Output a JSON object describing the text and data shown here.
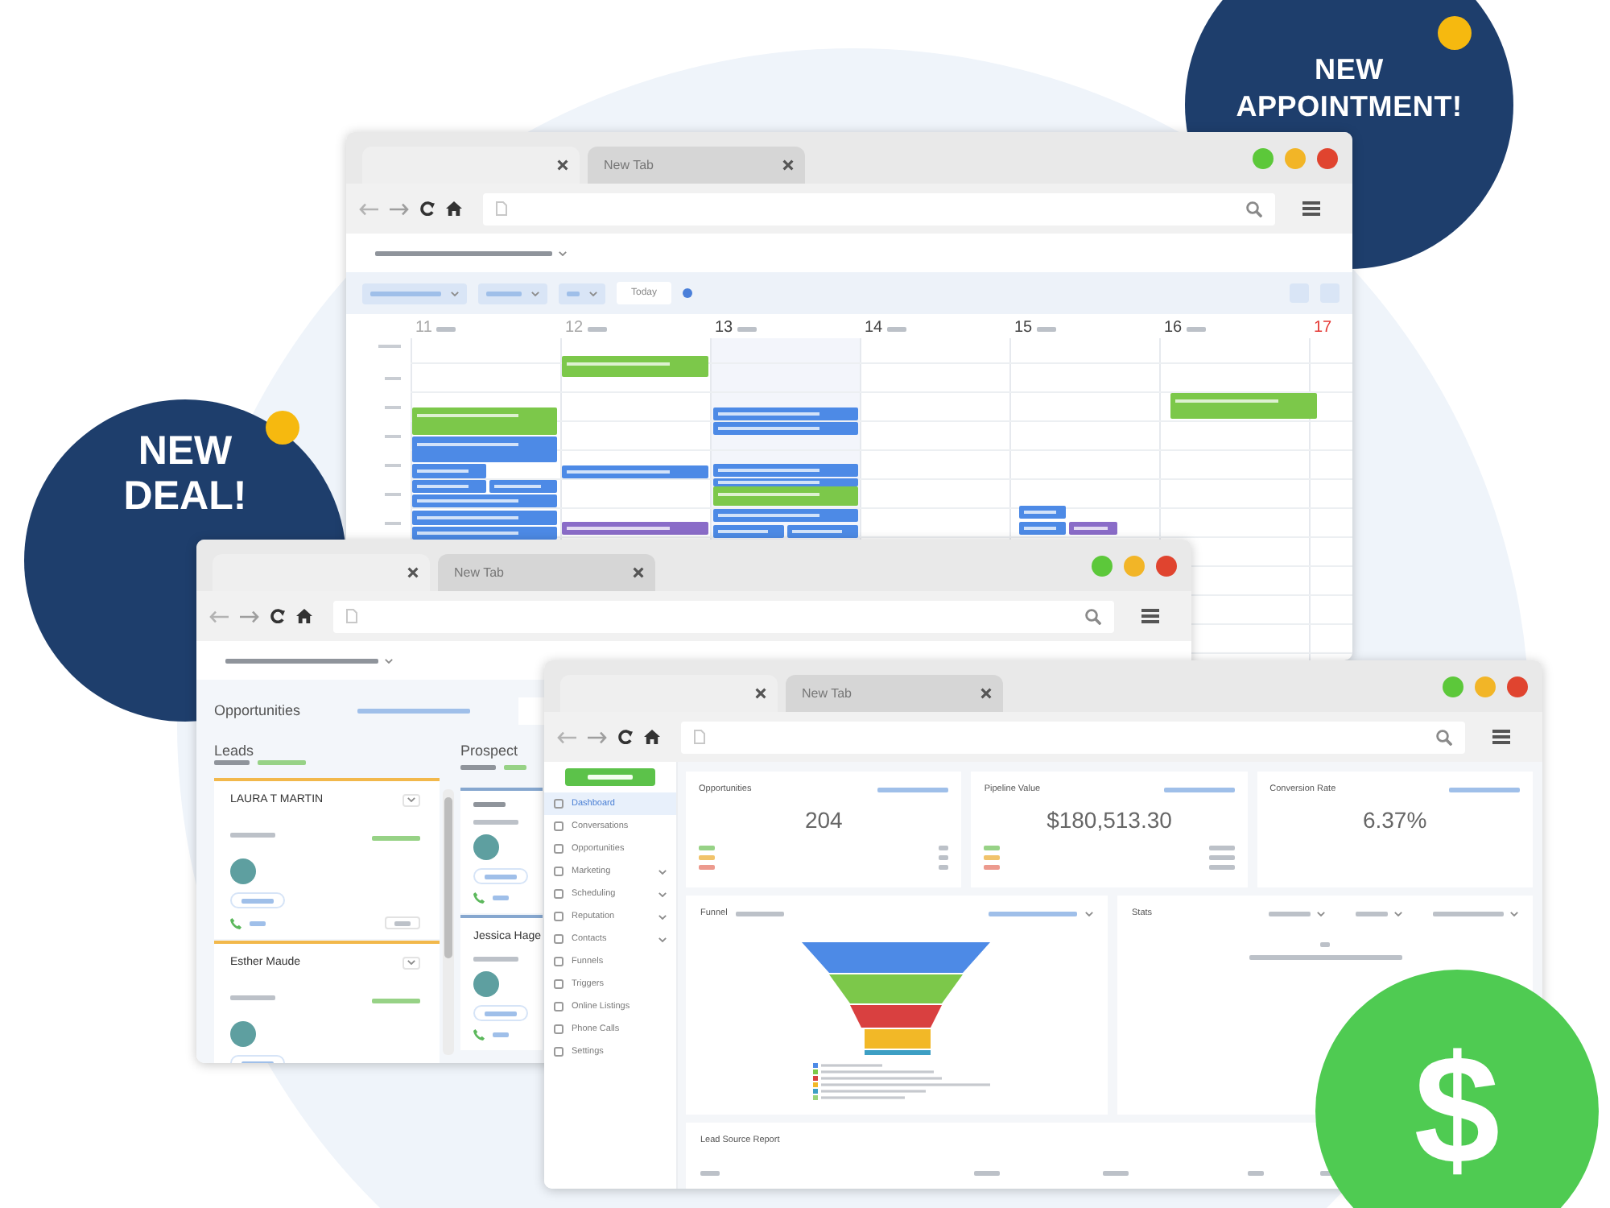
{
  "badges": [
    {
      "kind": "appointment",
      "lines": [
        "NEW",
        "APPOINTMENT!"
      ]
    },
    {
      "kind": "deal",
      "lines": [
        "NEW",
        "DEAL!"
      ]
    },
    {
      "kind": "dollar",
      "lines": [
        "$"
      ]
    }
  ],
  "calendar_window": {
    "tabs": [
      {
        "selected": true
      },
      {
        "label": "New Tab",
        "selected": false
      }
    ],
    "today_button": "Today",
    "days": [
      {
        "number": "11",
        "color": "#a8a8a8"
      },
      {
        "number": "12",
        "color": "#a8a8a8"
      },
      {
        "number": "13",
        "color": "#444444"
      },
      {
        "number": "14",
        "color": "#444444"
      },
      {
        "number": "15",
        "color": "#444444"
      },
      {
        "number": "16",
        "color": "#444444"
      },
      {
        "number": "17",
        "color": "#e53935"
      }
    ]
  },
  "pipeline_window": {
    "tabs": [
      {
        "selected": true
      },
      {
        "label": "New Tab",
        "selected": false
      }
    ],
    "title": "Opportunities",
    "columns": [
      {
        "name": "Leads",
        "color": "#f2b84b",
        "cards": [
          {
            "kind": "named",
            "name": "LAURA T MARTIN"
          },
          {
            "kind": "named",
            "name": "Esther Maude"
          }
        ]
      },
      {
        "name": "Prospect",
        "color": "#86a7cf",
        "cards": [
          {
            "kind": "blurred"
          },
          {
            "kind": "named",
            "name": "Jessica Hage"
          }
        ]
      }
    ]
  },
  "dashboard_window": {
    "tabs": [
      {
        "selected": true
      },
      {
        "label": "New Tab",
        "selected": false
      }
    ],
    "sidebar": {
      "items": [
        {
          "label": "Dashboard",
          "selected": true,
          "expandable": false
        },
        {
          "label": "Conversations",
          "selected": false,
          "expandable": false
        },
        {
          "label": "Opportunities",
          "selected": false,
          "expandable": false
        },
        {
          "label": "Marketing",
          "selected": false,
          "expandable": true
        },
        {
          "label": "Scheduling",
          "selected": false,
          "expandable": true
        },
        {
          "label": "Reputation",
          "selected": false,
          "expandable": true
        },
        {
          "label": "Contacts",
          "selected": false,
          "expandable": true
        },
        {
          "label": "Funnels",
          "selected": false,
          "expandable": false
        },
        {
          "label": "Triggers",
          "selected": false,
          "expandable": false
        },
        {
          "label": "Online Listings",
          "selected": false,
          "expandable": false
        },
        {
          "label": "Phone Calls",
          "selected": false,
          "expandable": false
        },
        {
          "label": "Settings",
          "selected": false,
          "expandable": false
        }
      ]
    },
    "metric_cards": [
      {
        "kind": "breakdown",
        "title": "Opportunities",
        "value": "204"
      },
      {
        "kind": "breakdown",
        "title": "Pipeline Value",
        "value": "$180,513.30"
      },
      {
        "kind": "plain",
        "title": "Conversion Rate",
        "value": "6.37%"
      }
    ],
    "panels": [
      {
        "kind": "funnel",
        "title": "Funnel"
      },
      {
        "kind": "stats",
        "title": "Stats"
      },
      {
        "kind": "report",
        "title": "Lead Source Report"
      }
    ]
  }
}
